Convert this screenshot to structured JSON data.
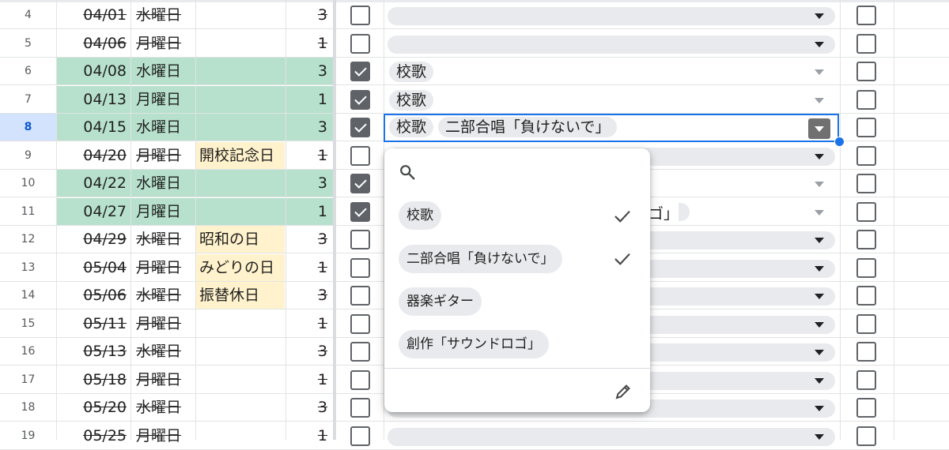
{
  "rows": [
    {
      "num": "4",
      "date": "04/01",
      "dow": "水曜日",
      "event": "",
      "count": "3",
      "strike": true,
      "green": false,
      "checked": false,
      "chips": [],
      "empty_pill": true
    },
    {
      "num": "5",
      "date": "04/06",
      "dow": "月曜日",
      "event": "",
      "count": "1",
      "strike": true,
      "green": false,
      "checked": false,
      "chips": [],
      "empty_pill": true
    },
    {
      "num": "6",
      "date": "04/08",
      "dow": "水曜日",
      "event": "",
      "count": "3",
      "strike": false,
      "green": true,
      "checked": true,
      "chips": [
        "校歌"
      ],
      "empty_pill": false
    },
    {
      "num": "7",
      "date": "04/13",
      "dow": "月曜日",
      "event": "",
      "count": "1",
      "strike": false,
      "green": true,
      "checked": true,
      "chips": [
        "校歌"
      ],
      "empty_pill": false
    },
    {
      "num": "8",
      "date": "04/15",
      "dow": "水曜日",
      "event": "",
      "count": "3",
      "strike": false,
      "green": true,
      "checked": true,
      "chips": [
        "校歌",
        "二部合唱「負けないで」"
      ],
      "empty_pill": false,
      "active": true
    },
    {
      "num": "9",
      "date": "04/20",
      "dow": "月曜日",
      "event": "開校記念日",
      "count": "1",
      "strike": true,
      "green": false,
      "checked": false,
      "chips": [],
      "empty_pill": true
    },
    {
      "num": "10",
      "date": "04/22",
      "dow": "水曜日",
      "event": "",
      "count": "3",
      "strike": false,
      "green": true,
      "checked": true,
      "chips": [],
      "empty_pill": false
    },
    {
      "num": "11",
      "date": "04/27",
      "dow": "月曜日",
      "event": "",
      "count": "1",
      "strike": false,
      "green": true,
      "checked": true,
      "chips": [],
      "empty_pill": false
    },
    {
      "num": "12",
      "date": "04/29",
      "dow": "水曜日",
      "event": "昭和の日",
      "count": "3",
      "strike": true,
      "green": false,
      "checked": false,
      "chips": [],
      "empty_pill": true
    },
    {
      "num": "13",
      "date": "05/04",
      "dow": "月曜日",
      "event": "みどりの日",
      "count": "1",
      "strike": true,
      "green": false,
      "checked": false,
      "chips": [],
      "empty_pill": true
    },
    {
      "num": "14",
      "date": "05/06",
      "dow": "水曜日",
      "event": "振替休日",
      "count": "3",
      "strike": true,
      "green": false,
      "checked": false,
      "chips": [],
      "empty_pill": true
    },
    {
      "num": "15",
      "date": "05/11",
      "dow": "月曜日",
      "event": "",
      "count": "1",
      "strike": true,
      "green": false,
      "checked": false,
      "chips": [],
      "empty_pill": true
    },
    {
      "num": "16",
      "date": "05/13",
      "dow": "水曜日",
      "event": "",
      "count": "3",
      "strike": true,
      "green": false,
      "checked": false,
      "chips": [],
      "empty_pill": true
    },
    {
      "num": "17",
      "date": "05/18",
      "dow": "月曜日",
      "event": "",
      "count": "1",
      "strike": true,
      "green": false,
      "checked": false,
      "chips": [],
      "empty_pill": true
    },
    {
      "num": "18",
      "date": "05/20",
      "dow": "水曜日",
      "event": "",
      "count": "3",
      "strike": true,
      "green": false,
      "checked": false,
      "chips": [],
      "empty_pill": true
    },
    {
      "num": "19",
      "date": "05/25",
      "dow": "月曜日",
      "event": "",
      "count": "1",
      "strike": true,
      "green": false,
      "checked": false,
      "chips": [],
      "empty_pill": true
    }
  ],
  "hidden_fragments": {
    "row11": "ゴ」"
  },
  "dropdown_menu": {
    "options": [
      {
        "label": "校歌",
        "selected": true
      },
      {
        "label": "二部合唱「負けないで」",
        "selected": true
      },
      {
        "label": "器楽ギター",
        "selected": false
      },
      {
        "label": "創作「サウンドロゴ」",
        "selected": false
      }
    ]
  },
  "colors": {
    "green_fill": "#b7e1cd",
    "holiday_fill": "#fff2cc",
    "chip_bg": "#e8eaed",
    "accent": "#1a73e8",
    "checkbox": "#5f6368"
  }
}
